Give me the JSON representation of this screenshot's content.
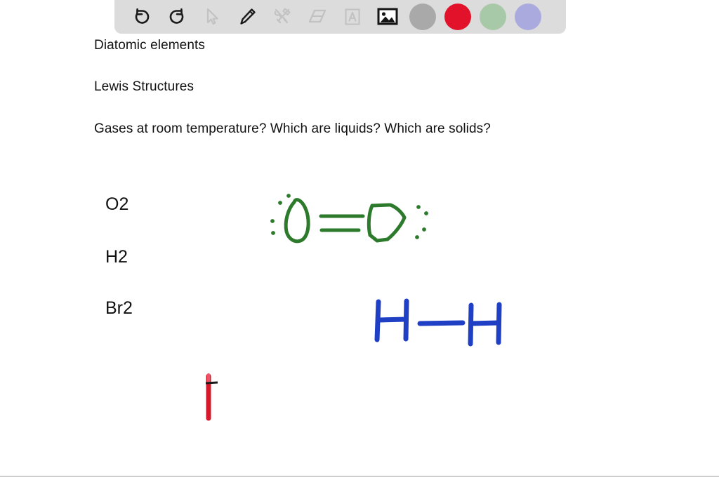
{
  "toolbar": {
    "background_color": "#dcdcdc",
    "tools": [
      {
        "name": "undo-icon",
        "label": "Undo",
        "state": "enabled"
      },
      {
        "name": "redo-icon",
        "label": "Redo",
        "state": "enabled"
      },
      {
        "name": "cursor-icon",
        "label": "Select",
        "state": "disabled"
      },
      {
        "name": "pencil-icon",
        "label": "Pencil",
        "state": "enabled"
      },
      {
        "name": "tools-icon",
        "label": "Tools",
        "state": "disabled"
      },
      {
        "name": "eraser-icon",
        "label": "Eraser",
        "state": "disabled"
      },
      {
        "name": "text-icon",
        "label": "Text",
        "state": "disabled"
      },
      {
        "name": "image-icon",
        "label": "Image",
        "state": "selected"
      }
    ],
    "swatches": [
      {
        "name": "color-swatch-gray",
        "label": "Gray",
        "color": "#a9a9a9",
        "selected": false
      },
      {
        "name": "color-swatch-red",
        "label": "Red",
        "color": "#e3122b",
        "selected": true
      },
      {
        "name": "color-swatch-green",
        "label": "Green",
        "color": "#a8c9a8",
        "selected": false
      },
      {
        "name": "color-swatch-purple",
        "label": "Purple",
        "color": "#aaaade",
        "selected": false
      }
    ]
  },
  "notes": {
    "title": "Diatomic elements",
    "subtitle": "Lewis Structures",
    "question": "Gases at room temperature? Which are liquids? Which are solids?"
  },
  "formulas": {
    "oxygen": "O2",
    "hydrogen": "H2",
    "bromine": "Br2"
  },
  "drawings": {
    "oxygen_structure": {
      "label": "O2 Lewis structure double bond with lone pairs",
      "color": "#2d7a2d",
      "bond": "double",
      "lone_pairs": 4
    },
    "hydrogen_structure": {
      "label": "H-H single bond",
      "color": "#1f3fc4",
      "bond": "single",
      "lone_pairs": 0
    },
    "pen_cursor": {
      "label": "Red pen stroke cursor",
      "color": "#d6182b"
    }
  }
}
